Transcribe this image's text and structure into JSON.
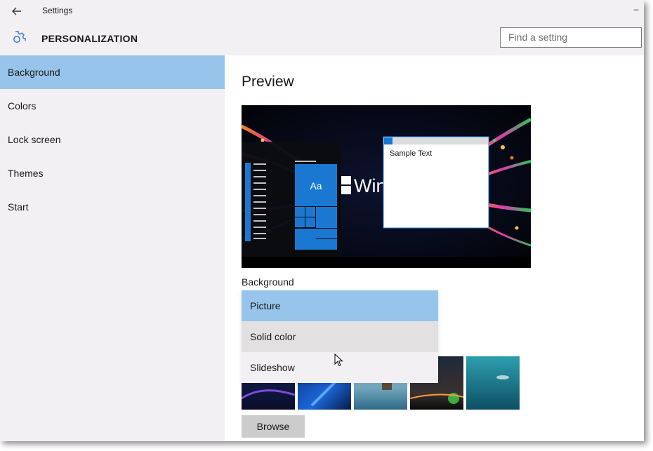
{
  "window": {
    "title": "Settings",
    "minimize_glyph": "–"
  },
  "header": {
    "title": "PERSONALIZATION",
    "icon": "gear-icon",
    "search_placeholder": "Find a setting"
  },
  "sidebar": {
    "items": [
      {
        "label": "Background",
        "selected": true
      },
      {
        "label": "Colors",
        "selected": false
      },
      {
        "label": "Lock screen",
        "selected": false
      },
      {
        "label": "Themes",
        "selected": false
      },
      {
        "label": "Start",
        "selected": false
      }
    ]
  },
  "main": {
    "preview_heading": "Preview",
    "preview": {
      "sample_text": "Sample Text",
      "tile_text": "Aa",
      "logo_text": "Win"
    },
    "background_label": "Background",
    "background_options": [
      {
        "label": "Picture",
        "state": "selected"
      },
      {
        "label": "Solid color",
        "state": "hover"
      },
      {
        "label": "Slideshow",
        "state": "normal"
      }
    ],
    "browse_label": "Browse"
  },
  "colors": {
    "accent": "#97c4ea",
    "tile_blue": "#1a78d3",
    "window_bg": "#f2f0f2",
    "hover": "#e2e0e1"
  }
}
